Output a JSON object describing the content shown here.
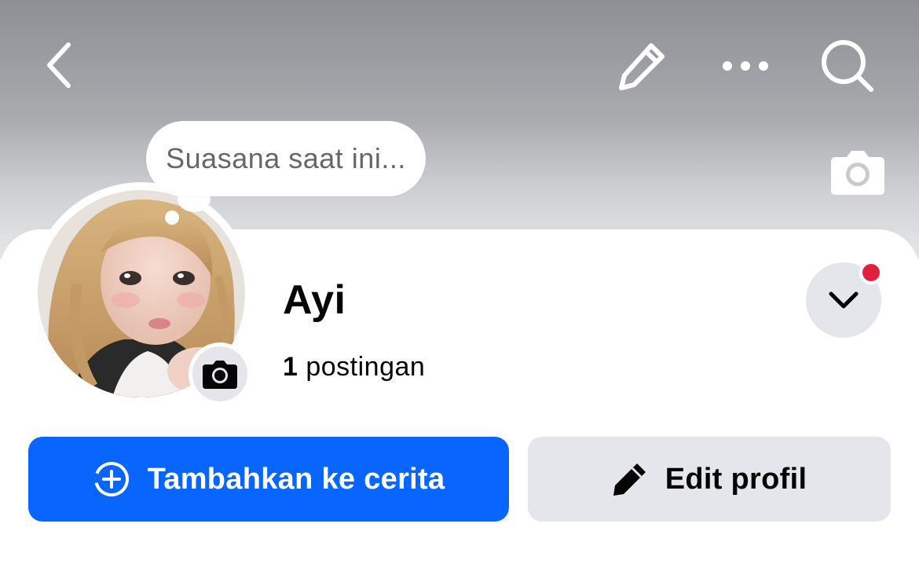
{
  "header": {
    "icons": [
      "chevron-left-icon",
      "pencil-icon",
      "more-dots-icon",
      "search-icon"
    ]
  },
  "cover": {
    "camera_icon": "camera-icon"
  },
  "profile": {
    "mood_placeholder": "Suasana saat ini...",
    "name": "Ayi",
    "post_count": "1",
    "post_label": " postingan",
    "avatar_camera_icon": "camera-icon",
    "has_notification": true
  },
  "actions": {
    "add_story_label": "Tambahkan ke cerita",
    "add_story_icon": "add-circle-icon",
    "edit_profile_label": "Edit profil",
    "edit_profile_icon": "pencil-icon"
  },
  "colors": {
    "primary_blue": "#0866ff",
    "secondary_gray": "#e4e6eb",
    "notification_red": "#e41e3f",
    "text_dark": "#050505",
    "text_muted": "#65676b"
  }
}
